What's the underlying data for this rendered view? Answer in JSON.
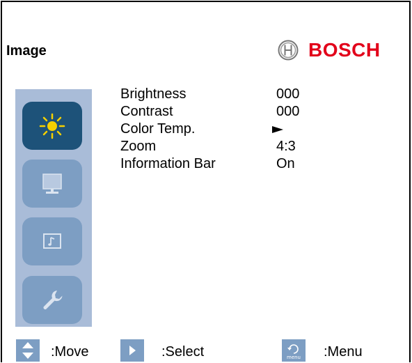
{
  "page": {
    "title": "Image",
    "brand": "BOSCH"
  },
  "sidebar": {
    "items": [
      {
        "icon": "sun-icon",
        "active": true
      },
      {
        "icon": "monitor-icon",
        "active": false
      },
      {
        "icon": "music-note-screen-icon",
        "active": false
      },
      {
        "icon": "wrench-icon",
        "active": false
      }
    ]
  },
  "menu": {
    "items": [
      {
        "label": "Brightness",
        "value": "000"
      },
      {
        "label": "Contrast",
        "value": "000"
      },
      {
        "label": "Color Temp.",
        "value": "",
        "icon": "right-arrow-icon"
      },
      {
        "label": "Zoom",
        "value": "4:3"
      },
      {
        "label": "Information Bar",
        "value": "On"
      }
    ]
  },
  "footer": {
    "move_label": ":Move",
    "select_label": ":Select",
    "menu_label": ":Menu",
    "menu_icon_text": "menu"
  },
  "colors": {
    "brand_red": "#e2001a",
    "sidebar_bg": "#a9bcd8",
    "active_button": "#1d5279",
    "inactive_button": "#7d9ec3",
    "sun_yellow": "#f5d000"
  }
}
